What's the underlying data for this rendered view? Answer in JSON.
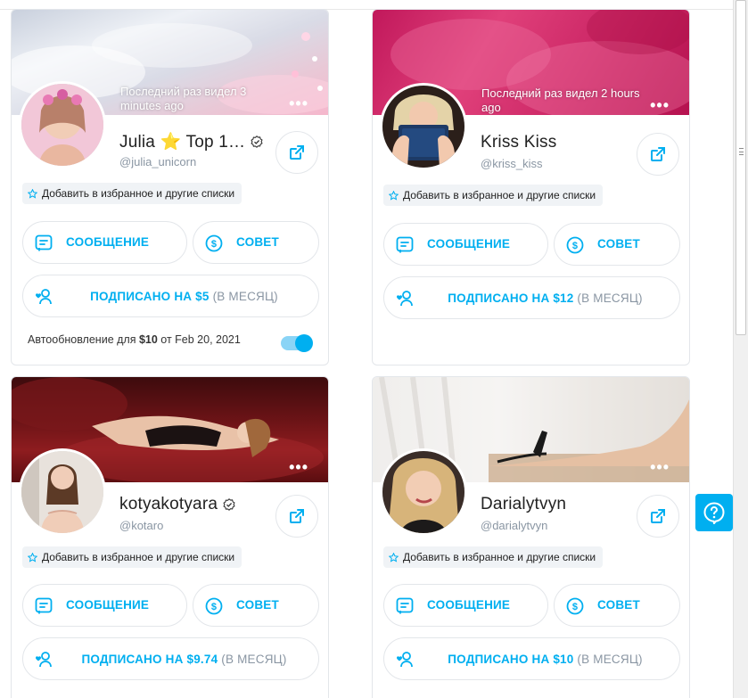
{
  "colors": {
    "accent": "#00aff0",
    "muted": "#8a96a3",
    "favBg": "#f0f3f6"
  },
  "cards": [
    {
      "name": "Julia ⭐ Top 1…",
      "handle": "@julia_unicorn",
      "verified": true,
      "last_seen": "Последний раз видел 3 minutes ago",
      "fav_label": "Добавить в избранное и другие списки",
      "message_label": "СООБЩЕНИЕ",
      "tip_label": "СОВЕТ",
      "subscribed_label": "ПОДПИСАНО НА $5",
      "subscribed_period": "(В МЕСЯЦ)",
      "renew_prefix": "Автообновление для ",
      "renew_price": "$10",
      "renew_suffix": " от Feb 20, 2021",
      "autorenew_on": true
    },
    {
      "name": "Kriss Kiss",
      "handle": "@kriss_kiss",
      "verified": false,
      "last_seen": "Последний раз видел 2 hours ago",
      "fav_label": "Добавить в избранное и другие списки",
      "message_label": "СООБЩЕНИЕ",
      "tip_label": "СОВЕТ",
      "subscribed_label": "ПОДПИСАНО НА $12",
      "subscribed_period": "(В МЕСЯЦ)"
    },
    {
      "name": "kotyakotyara",
      "handle": "@kotaro",
      "verified": true,
      "fav_label": "Добавить в избранное и другие списки",
      "message_label": "СООБЩЕНИЕ",
      "tip_label": "СОВЕТ",
      "subscribed_label": "ПОДПИСАНО НА $9.74",
      "subscribed_period": "(В МЕСЯЦ)"
    },
    {
      "name": "Darialytvyn",
      "handle": "@darialytvyn",
      "verified": false,
      "fav_label": "Добавить в избранное и другие списки",
      "message_label": "СООБЩЕНИЕ",
      "tip_label": "СОВЕТ",
      "subscribed_label": "ПОДПИСАНО НА $10",
      "subscribed_period": "(В МЕСЯЦ)"
    }
  ],
  "more_icon": "more-dots-icon",
  "help_icon": "help-icon"
}
